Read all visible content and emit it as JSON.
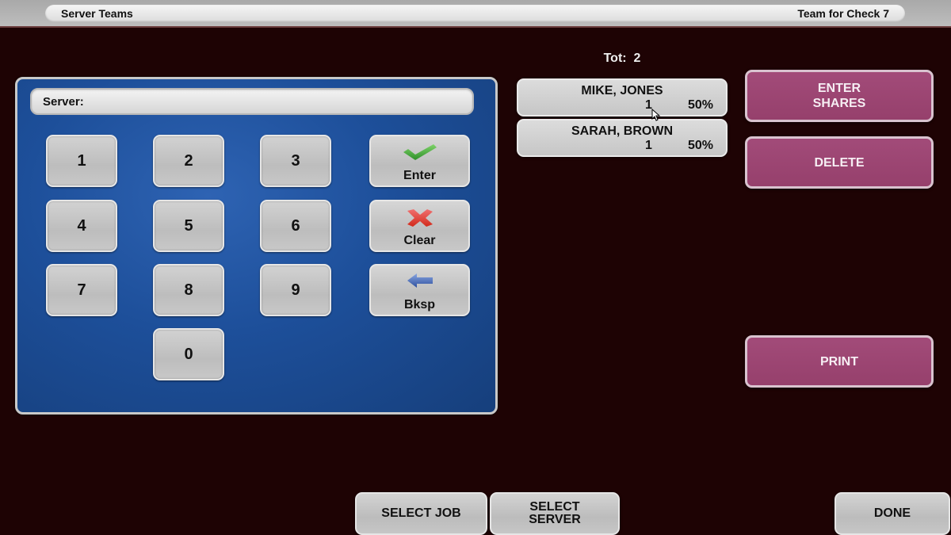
{
  "header": {
    "title_left": "Server Teams",
    "title_right": "Team for Check 7"
  },
  "keypad": {
    "server_label": "Server:",
    "server_value": "",
    "digits": [
      "1",
      "2",
      "3",
      "4",
      "5",
      "6",
      "7",
      "8",
      "9",
      "0"
    ],
    "enter_label": "Enter",
    "clear_label": "Clear",
    "bksp_label": "Bksp",
    "icons": {
      "enter": "checkmark-icon",
      "clear": "x-icon",
      "bksp": "left-arrow-icon"
    }
  },
  "team": {
    "total_label": "Tot:",
    "total_value": "2",
    "members": [
      {
        "name": "MIKE, JONES",
        "count": "1",
        "percent": "50%"
      },
      {
        "name": "SARAH, BROWN",
        "count": "1",
        "percent": "50%"
      }
    ]
  },
  "actions": {
    "enter_shares_line1": "ENTER",
    "enter_shares_line2": "SHARES",
    "delete": "DELETE",
    "print": "PRINT"
  },
  "footer": {
    "select_job": "SELECT JOB",
    "select_server_line1": "SELECT",
    "select_server_line2": "SERVER",
    "done": "DONE"
  },
  "colors": {
    "background": "#1e0304",
    "panel_blue": "#1d4f9a",
    "action_pink": "#9c4573",
    "button_gray": "#c6c6c6"
  }
}
